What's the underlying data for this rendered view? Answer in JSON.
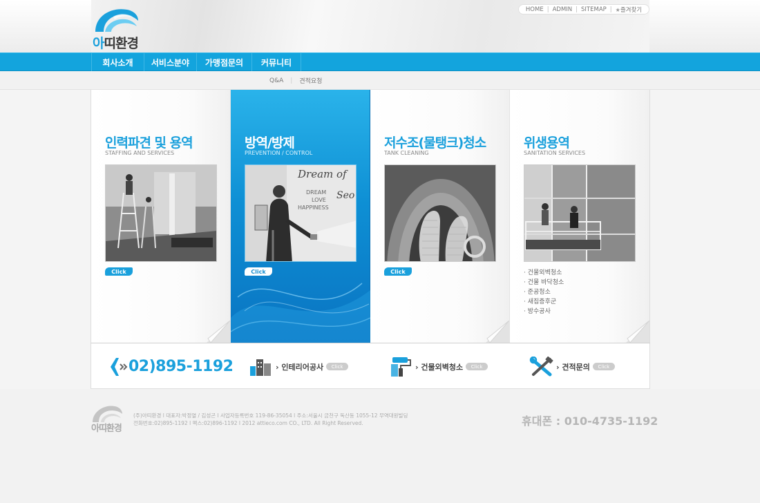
{
  "logo": {
    "first_char": "아",
    "rest": "띠환경"
  },
  "utilnav": {
    "items": [
      "HOME",
      "ADMIN",
      "SITEMAP",
      "즐겨찾기"
    ]
  },
  "gnb": {
    "items": [
      "회사소개",
      "서비스분야",
      "가맹점문의",
      "커뮤니티"
    ]
  },
  "subnav": {
    "items": [
      "Q&A",
      "견적요청"
    ]
  },
  "panels": [
    {
      "title": "인력파견 및 용역",
      "subtitle": "STAFFING AND SERVICES",
      "click": "Click"
    },
    {
      "title": "방역/방제",
      "subtitle": "PREVENTION / CONTROL",
      "click": "Click",
      "photo_text": [
        "Dream of",
        "Seo",
        "DREAM",
        "LOVE",
        "HAPPINESS"
      ]
    },
    {
      "title": "저수조(물탱크)청소",
      "subtitle": "TANK CLEANING",
      "click": "Click"
    },
    {
      "title": "위생용역",
      "subtitle": "SANITATION SERVICES",
      "links": [
        "건물외벽청소",
        "건물 바닥청소",
        "준공청소",
        "새집증후군",
        "방수공사"
      ]
    }
  ],
  "quickbar": {
    "phone": "02)895-1192",
    "items": [
      {
        "label": "인테리어공사",
        "click": "Click"
      },
      {
        "label": "건물외벽청소",
        "click": "Click"
      },
      {
        "label": "견적문의",
        "click": "Click"
      }
    ]
  },
  "footer": {
    "logo_text": "아띠환경",
    "line1": "(주)아띠환경 l 대표자:박정열 / 김성곤 l 사업자등록번호 119-86-35054 l 주소:서울시 금천구 독산동 1055-12 무역대원빌딩",
    "line2": "전화번호:02)895-1192 l 팩스:02)896-1192 l 2012 attieco.com CO., LTD. All Right Reserved.",
    "mobile": "휴대폰 : 010-4735-1192"
  },
  "colors": {
    "brand": "#1aa0dc",
    "gnb": "#13a4dd"
  }
}
